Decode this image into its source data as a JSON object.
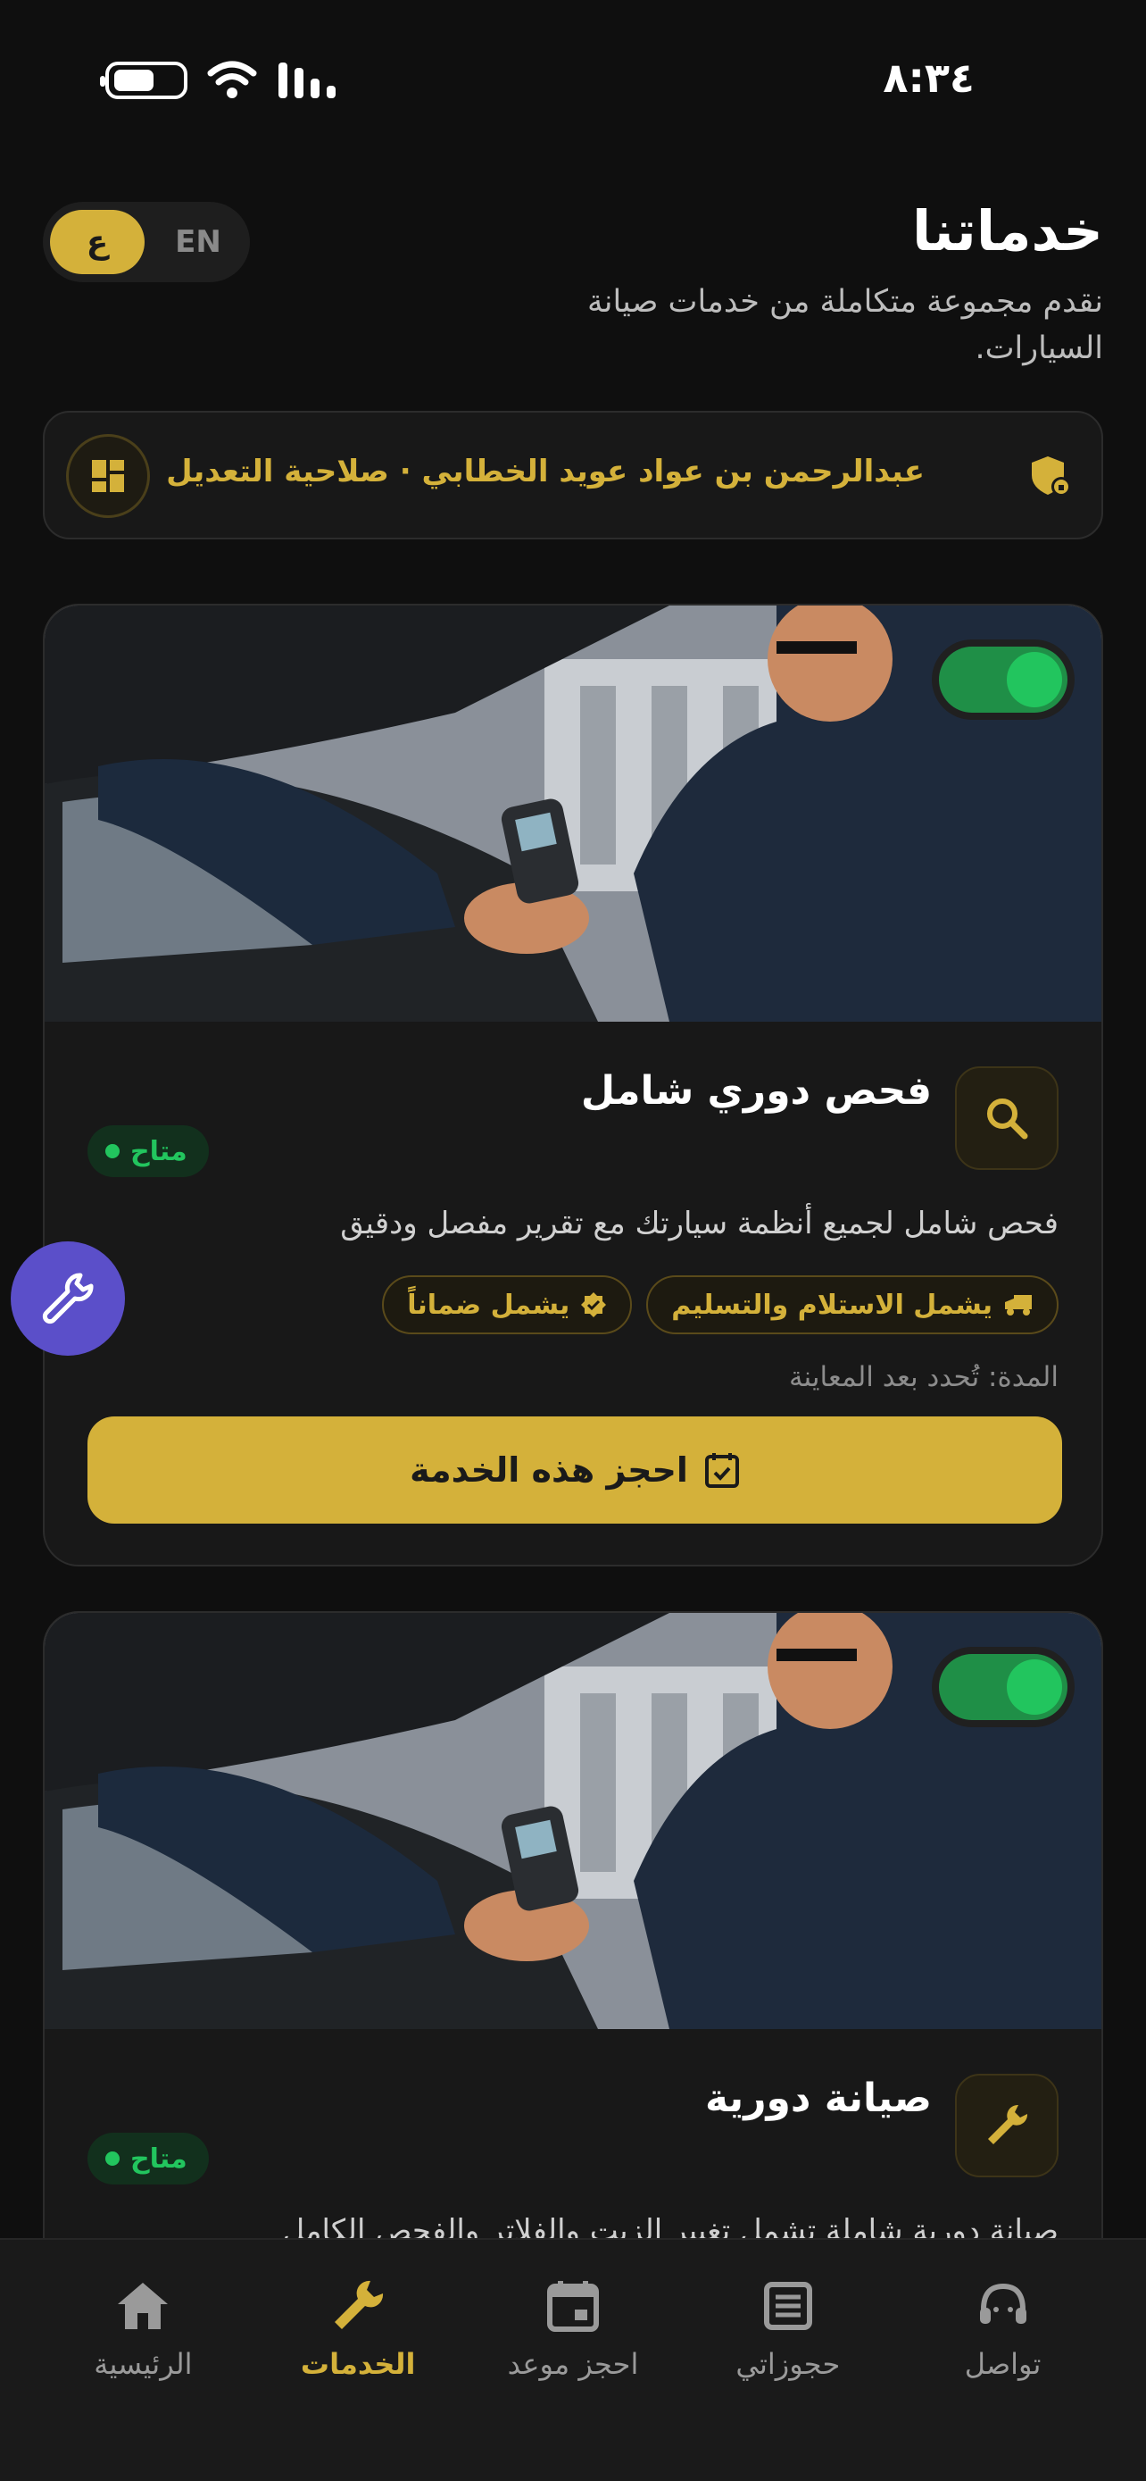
{
  "status_bar": {
    "time": "٨:٣٤"
  },
  "header": {
    "title": "خدماتنا",
    "subtitle": "نقدم مجموعة متكاملة من خدمات صيانة السيارات.",
    "lang_ar": "ع",
    "lang_en": "EN"
  },
  "admin_bar": {
    "text": "عبدالرحمن بن عواد عويد الخطابي · صلاحية التعديل"
  },
  "services": [
    {
      "title": "فحص دوري شامل",
      "status": "متاح",
      "description": "فحص شامل لجميع أنظمة سيارتك مع تقرير مفصل ودقيق",
      "chips": [
        "يشمل الاستلام والتسليم",
        "يشمل ضماناً"
      ],
      "duration": "المدة: تُحدد بعد المعاينة",
      "book_label": "احجز هذه الخدمة",
      "enabled": true,
      "icon": "search-icon"
    },
    {
      "title": "صيانة دورية",
      "status": "متاح",
      "description": "صيانة دورية شاملة تشمل تغيير الزيت والفلاتر والفحص الكامل",
      "enabled": true,
      "icon": "wrench-icon"
    }
  ],
  "nav": {
    "items": [
      {
        "label": "تواصل",
        "icon": "support-headset-icon"
      },
      {
        "label": "حجوزاتي",
        "icon": "list-icon"
      },
      {
        "label": "احجز موعد",
        "icon": "calendar-icon"
      },
      {
        "label": "الخدمات",
        "icon": "wrench-icon",
        "active": true
      },
      {
        "label": "الرئيسية",
        "icon": "home-icon"
      }
    ]
  },
  "colors": {
    "accent": "#d4b13a",
    "background": "#0f0f0f",
    "card": "#181818",
    "success": "#22c55e",
    "fab": "#5b4fc9"
  }
}
